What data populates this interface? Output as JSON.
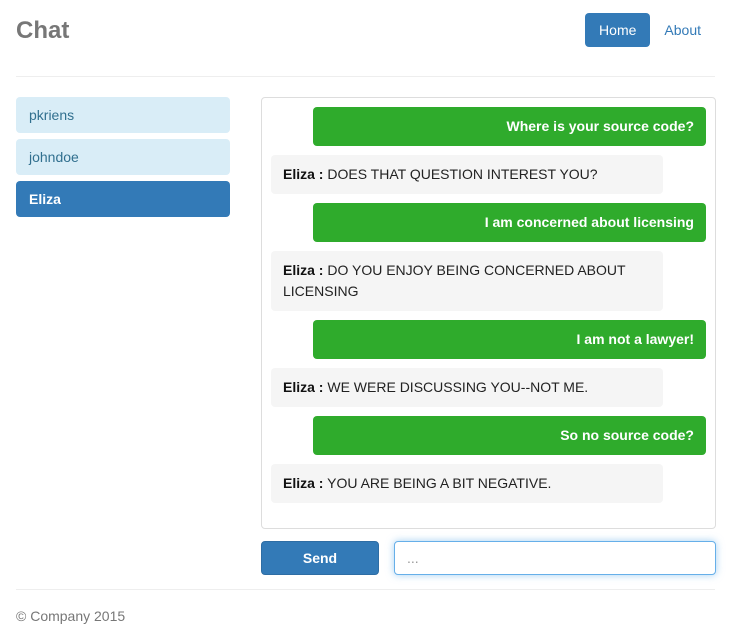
{
  "header": {
    "brand": "Chat",
    "nav": [
      {
        "label": "Home",
        "active": true
      },
      {
        "label": "About",
        "active": false
      }
    ]
  },
  "sidebar": {
    "users": [
      {
        "name": "pkriens",
        "active": false
      },
      {
        "name": "johndoe",
        "active": false
      },
      {
        "name": "Eliza",
        "active": true
      }
    ]
  },
  "chat": {
    "messages": [
      {
        "direction": "out",
        "sender": "",
        "text": "Where is your source code?"
      },
      {
        "direction": "in",
        "sender": "Eliza :",
        "text": "DOES THAT QUESTION INTEREST YOU?"
      },
      {
        "direction": "out",
        "sender": "",
        "text": "I am concerned about licensing"
      },
      {
        "direction": "in",
        "sender": "Eliza :",
        "text": "DO YOU ENJOY BEING CONCERNED ABOUT LICENSING"
      },
      {
        "direction": "out",
        "sender": "",
        "text": "I am not a lawyer!"
      },
      {
        "direction": "in",
        "sender": "Eliza :",
        "text": "WE WERE DISCUSSING YOU--NOT ME."
      },
      {
        "direction": "out",
        "sender": "",
        "text": "So no source code?"
      },
      {
        "direction": "in",
        "sender": "Eliza :",
        "text": "YOU ARE BEING A BIT NEGATIVE."
      }
    ]
  },
  "composer": {
    "send_label": "Send",
    "input_value": "",
    "input_placeholder": "..."
  },
  "footer": {
    "copyright": "© Company 2015"
  },
  "colors": {
    "primary_blue": "#337ab7",
    "message_green": "#2fab2c",
    "list_info_blue": "#d9edf7",
    "bubble_gray": "#f5f5f5",
    "muted_text": "#777777",
    "focus_blue": "#66afe9"
  }
}
